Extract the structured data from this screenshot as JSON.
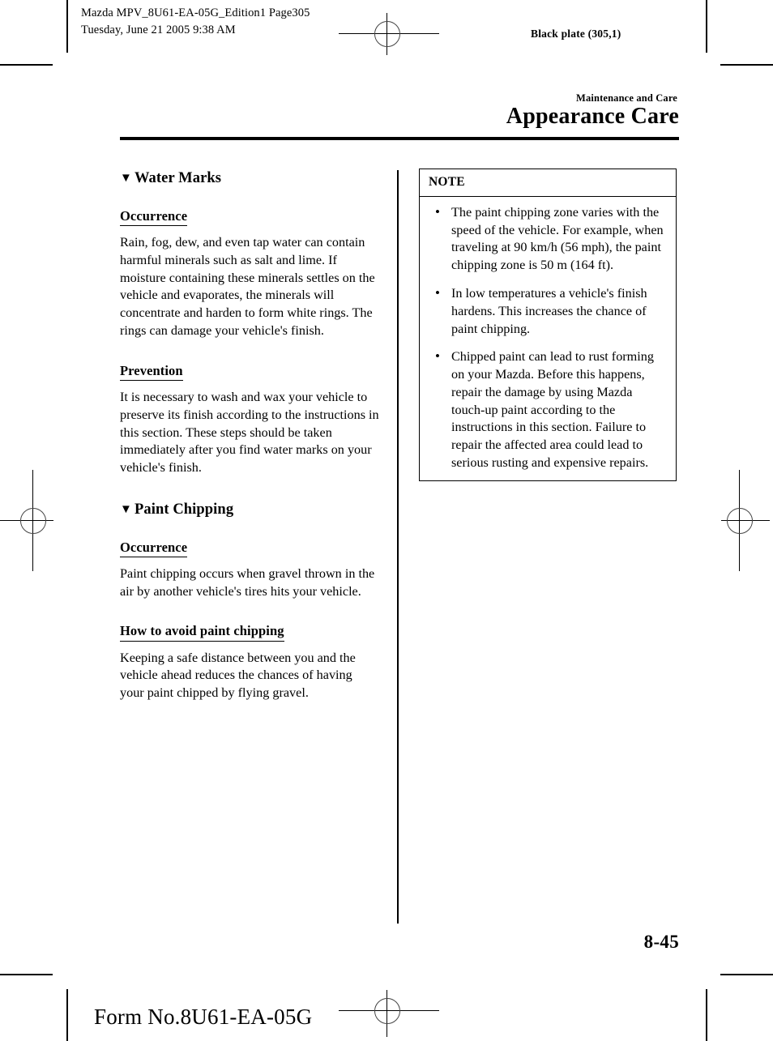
{
  "print_marks": {
    "job_info": "Mazda MPV_8U61-EA-05G_Edition1 Page305\nTuesday, June 21 2005 9:38 AM",
    "black_plate": "Black plate (305,1)",
    "form_number": "Form No.8U61-EA-05G"
  },
  "header": {
    "kicker": "Maintenance and Care",
    "title": "Appearance Care"
  },
  "left_column": {
    "topic1": {
      "marker": "▼",
      "heading": "Water Marks",
      "sections": [
        {
          "subheading": "Occurrence",
          "text": "Rain, fog, dew, and even tap water can contain harmful minerals such as salt and lime. If moisture containing these minerals settles on the vehicle and evaporates, the minerals will concentrate and harden to form white rings. The rings can damage your vehicle's finish."
        },
        {
          "subheading": "Prevention",
          "text": "It is necessary to wash and wax your vehicle to preserve its finish according to the instructions in this section. These steps should be taken immediately after you find water marks on your vehicle's finish."
        }
      ]
    },
    "topic2": {
      "marker": "▼",
      "heading": "Paint Chipping",
      "sections": [
        {
          "subheading": "Occurrence",
          "text": "Paint chipping occurs when gravel thrown in the air by another vehicle's tires hits your vehicle."
        },
        {
          "subheading": "How to avoid paint chipping",
          "text": "Keeping a safe distance between you and the vehicle ahead reduces the chances of having your paint chipped by flying gravel."
        }
      ]
    }
  },
  "right_column": {
    "note": {
      "title": "NOTE",
      "bullet_glyph": "•",
      "items": [
        "The paint chipping zone varies with the speed of the vehicle. For example, when traveling at 90 km/h (56 mph), the paint chipping zone is 50 m (164 ft).",
        "In low temperatures a vehicle's finish hardens. This increases the chance of paint chipping.",
        "Chipped paint can lead to rust forming on your Mazda. Before this happens, repair the damage by using Mazda touch-up paint according to the instructions in this section. Failure to repair the affected area could lead to serious rusting and expensive repairs."
      ]
    }
  },
  "footer": {
    "page_number": "8-45"
  }
}
